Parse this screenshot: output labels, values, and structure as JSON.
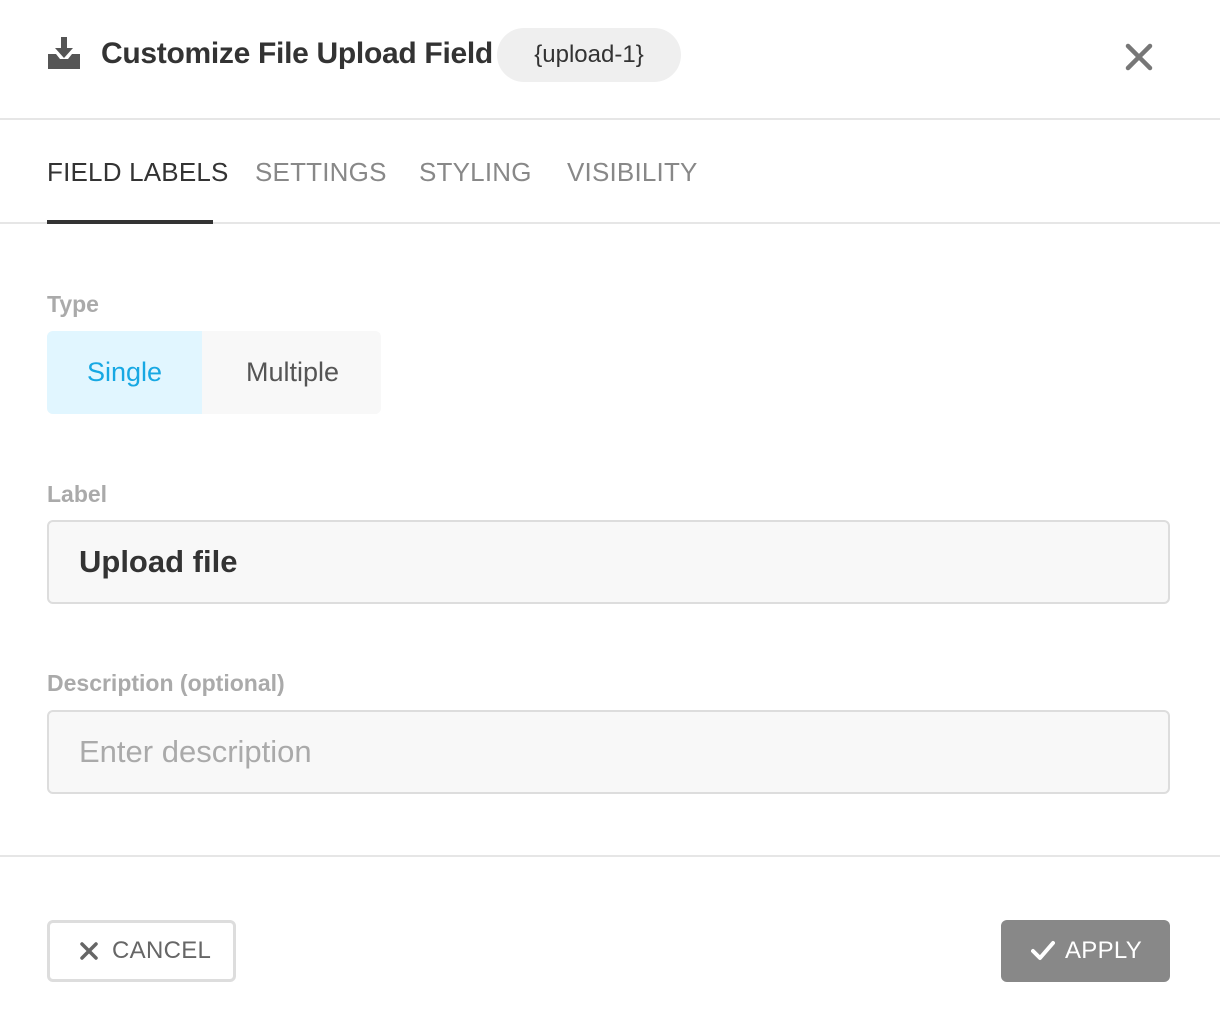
{
  "header": {
    "title": "Customize File Upload Field",
    "field_tag": "{upload-1}",
    "icon": "download-tray-icon",
    "close_icon": "close-icon"
  },
  "tabs": [
    {
      "label": "FIELD LABELS",
      "active": true
    },
    {
      "label": "SETTINGS",
      "active": false
    },
    {
      "label": "STYLING",
      "active": false
    },
    {
      "label": "VISIBILITY",
      "active": false
    }
  ],
  "form": {
    "type": {
      "label": "Type",
      "options": [
        "Single",
        "Multiple"
      ],
      "selected": "Single"
    },
    "label_field": {
      "label": "Label",
      "value": "Upload file"
    },
    "description_field": {
      "label": "Description (optional)",
      "value": "",
      "placeholder": "Enter description"
    }
  },
  "footer": {
    "cancel_label": "CANCEL",
    "cancel_icon": "close-icon",
    "apply_label": "APPLY",
    "apply_icon": "checkmark-icon"
  },
  "colors": {
    "accent": "#17a8e3",
    "selected_bg": "#e1f6ff",
    "apply_bg": "#888888"
  }
}
